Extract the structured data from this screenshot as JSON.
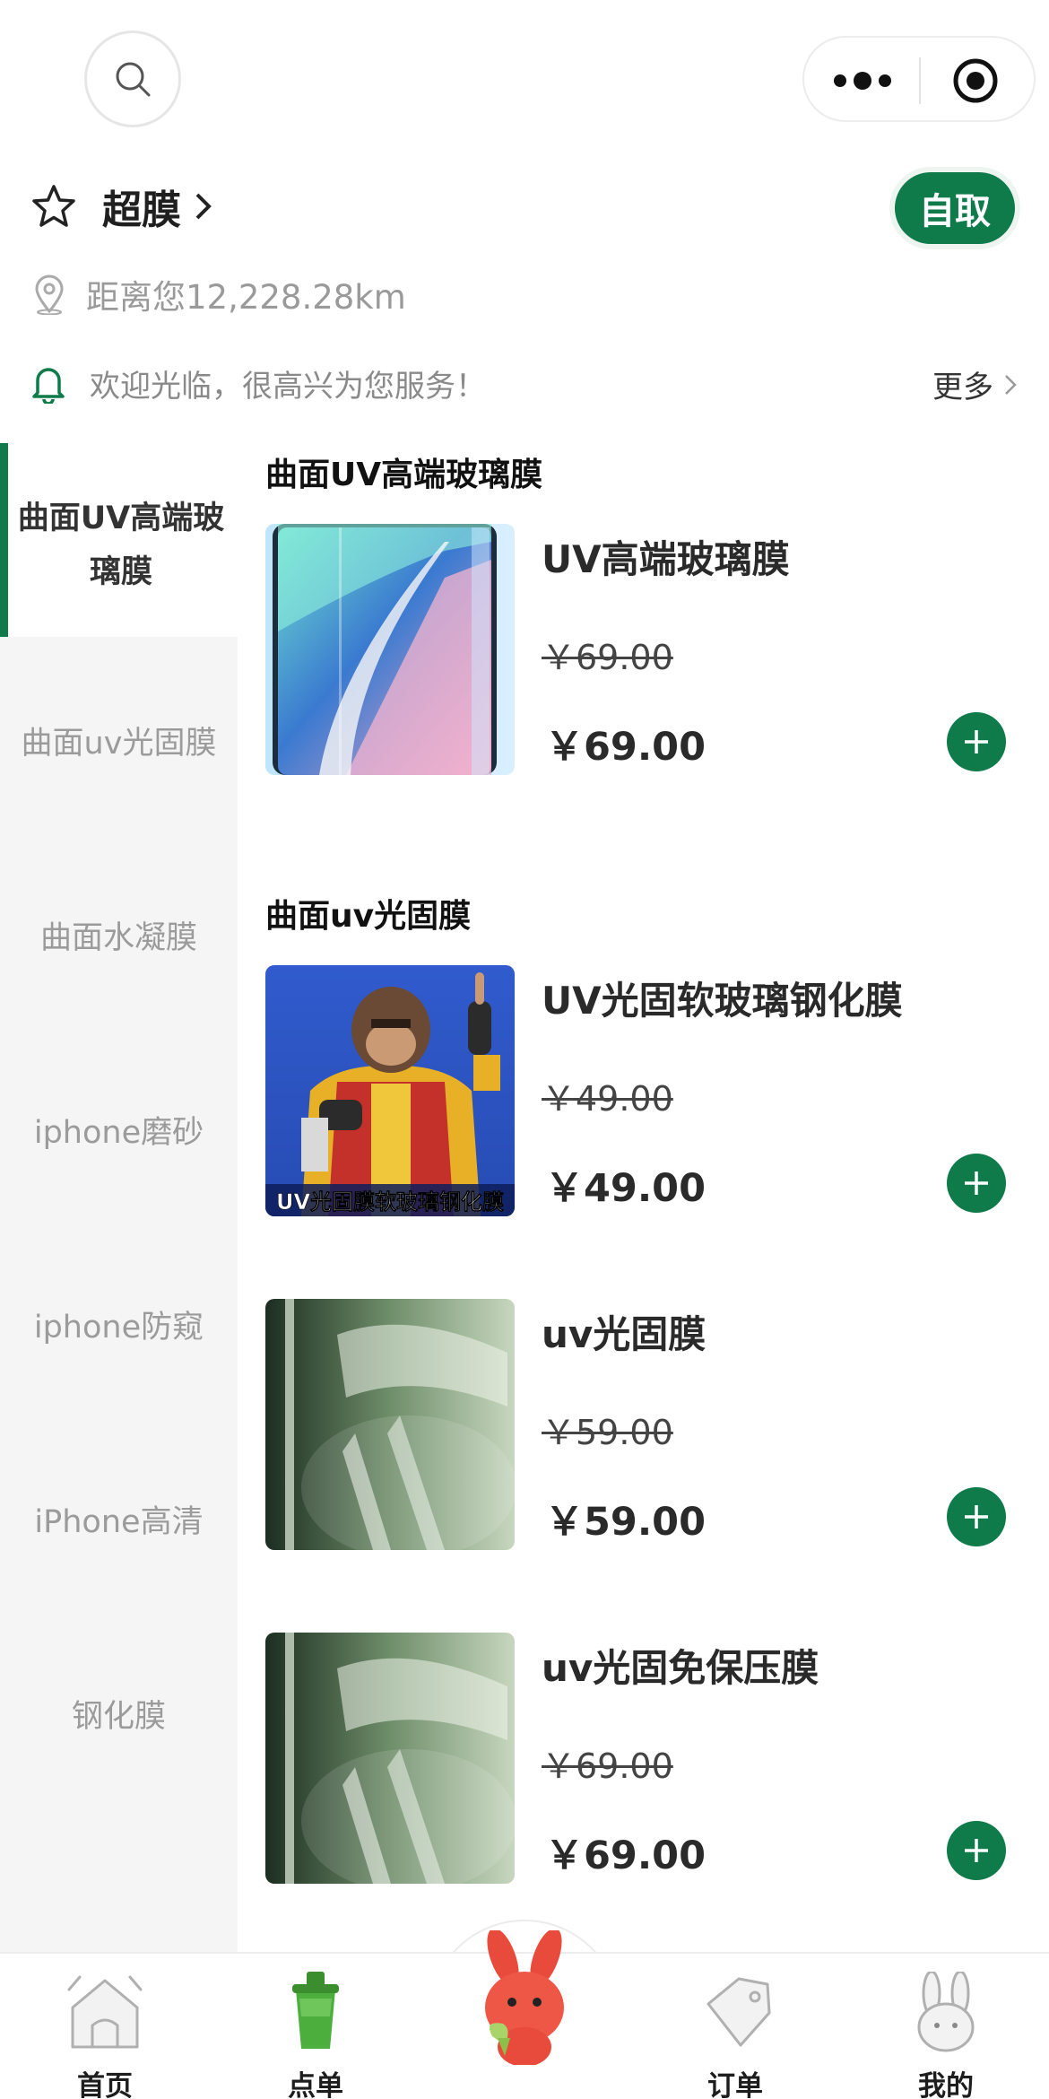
{
  "store": {
    "name": "超膜",
    "pickup_label": "自取",
    "distance": "距离您12,228.28km",
    "notice": "欢迎光临，很高兴为您服务！",
    "more_label": "更多"
  },
  "sidebar": {
    "active": "曲面UV高端玻璃膜",
    "items": [
      "曲面uv光固膜",
      "曲面水凝膜",
      "iphone磨砂",
      "iphone防窥",
      "iPhone高清",
      "钢化膜"
    ]
  },
  "sections": [
    {
      "title": "曲面UV高端玻璃膜",
      "products": [
        {
          "name": "UV高端玻璃膜",
          "old_price": "￥69.00",
          "price": "￥69.00"
        }
      ]
    },
    {
      "title": "曲面uv光固膜",
      "products": [
        {
          "name": "UV光固软玻璃钢化膜",
          "old_price": "￥49.00",
          "price": "￥49.00",
          "image_caption": "UV光固膜软玻璃钢化膜"
        },
        {
          "name": "uv光固膜",
          "old_price": "￥59.00",
          "price": "￥59.00"
        },
        {
          "name": "uv光固免保压膜",
          "old_price": "￥69.00",
          "price": "￥69.00"
        }
      ]
    }
  ],
  "tabbar": {
    "items": [
      {
        "label": "首页",
        "icon": "home-icon"
      },
      {
        "label": "点单",
        "icon": "cup-icon"
      },
      {
        "label": "",
        "icon": "mascot-icon"
      },
      {
        "label": "订单",
        "icon": "tag-icon"
      },
      {
        "label": "我的",
        "icon": "rabbit-icon"
      }
    ]
  },
  "colors": {
    "accent": "#0f7a4a",
    "sidebar_bg": "#f5f5f5"
  }
}
